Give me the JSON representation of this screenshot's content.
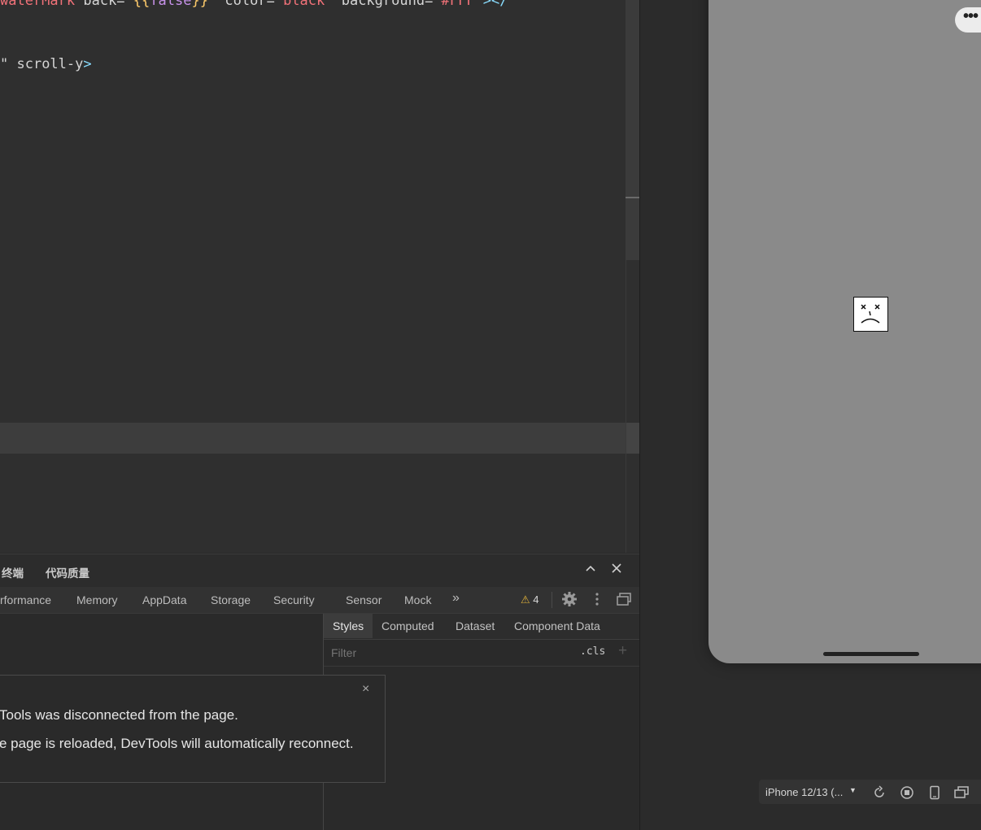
{
  "editor": {
    "line1": {
      "attr": "waterMark",
      "p1": " back=\"",
      "brace_open": "{{",
      "bool": "false",
      "brace_close": "}}",
      "p2": "\" color=\"",
      "color": "black",
      "p3": "\" background=\"",
      "bg": "#FFF",
      "p4": "\"",
      "close": "></"
    },
    "line2": {
      "q": "\"",
      "text": " scroll-y",
      "close": ">"
    }
  },
  "bottom_panel": {
    "tab_terminal": "终端",
    "tab_quality": "代码质量",
    "collapse_icon": "chevron-up-icon",
    "close_icon": "close-icon"
  },
  "devtools": {
    "tabs": [
      "rformance",
      "Memory",
      "AppData",
      "Storage",
      "Security",
      "Sensor",
      "Mock"
    ],
    "more": "»",
    "warning_count": "4",
    "warning_color": "#e0b23a"
  },
  "styles_pane": {
    "tabs": [
      "Styles",
      "Computed",
      "Dataset",
      "Component Data"
    ],
    "active_tab": "Styles",
    "filter_placeholder": "Filter",
    "cls_label": ".cls",
    "plus_label": "+"
  },
  "toast": {
    "line1": "Tools was disconnected from the page.",
    "line2": "e page is reloaded, DevTools will automatically reconnect.",
    "close": "×"
  },
  "simulator": {
    "device_label": "iPhone 12/13 (...",
    "capsule_dots": "•••",
    "screen_color": "#8a8a8a"
  }
}
